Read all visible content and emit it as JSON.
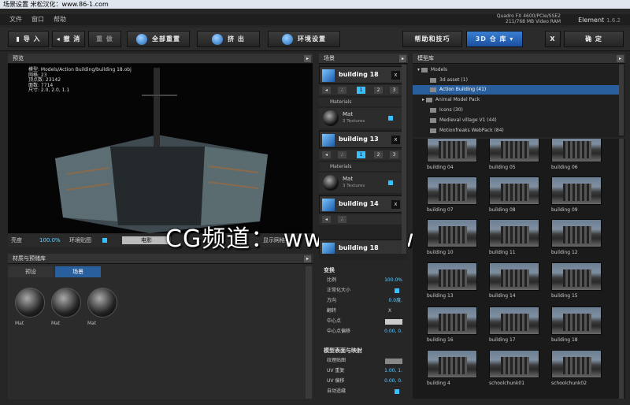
{
  "titlebar": {
    "title": "场景设置 米松汉化：www.86-1.com"
  },
  "menu": [
    "文件",
    "窗口",
    "帮助"
  ],
  "gpu": {
    "line1": "Quadro FX 4600/PCIe/SSE2",
    "line2": "211/768 MB Video RAM"
  },
  "app": {
    "name": "Element",
    "version": "1.6.2"
  },
  "toolbar": {
    "import": "导 入",
    "undo": "撤 消",
    "redo": "重 做",
    "reset": "全部重置",
    "export": "挤 出",
    "env": "环境设置",
    "help": "帮助和技巧",
    "store": "3D 仓 库",
    "close": "X",
    "ok": "确 定"
  },
  "preview": {
    "title": "预览",
    "info": [
      "模型: Models/Action Building/building 18.obj",
      "网格: 23",
      "顶点数: 23142",
      "面数: 7714",
      "尺寸: 2.0, 2.0, 1.1"
    ]
  },
  "vpbar": {
    "bright_label": "亮度",
    "bright_value": "100.0%",
    "env_label": "环境贴图",
    "mode": "电影",
    "grid": "显示网格"
  },
  "watermark": "CG频道： www.cgown.com",
  "materials": {
    "title": "材质与预储库",
    "tab_preset": "预设",
    "tab_scene": "场景",
    "items": [
      "Mat",
      "Mat",
      "Mat"
    ]
  },
  "scene": {
    "title": "场景",
    "objects": [
      "building 18",
      "building 13",
      "building 14",
      "building 18"
    ],
    "materials_label": "Materials",
    "mat_name": "Mat",
    "mat_tex": "3 Textures",
    "nums": [
      "1",
      "2",
      "3"
    ]
  },
  "props": {
    "transform": "变换",
    "scale": "比例",
    "scale_v": "100.0%",
    "normalize": "正常化大小",
    "dir": "方向",
    "dir_v": "0.0度.",
    "flip": "翻转",
    "flip_v": "X",
    "center": "中心点",
    "offset": "中心点偏移",
    "offset_v": "0.00, 0.",
    "mapping": "模型表面与映射",
    "texmap": "纹理贴图",
    "uvrep": "UV 重复",
    "uvrep_v": "1.00, 1.",
    "uvoff": "UV 偏移",
    "uvoff_v": "0.00, 0.",
    "autoseam": "自动适缝"
  },
  "library": {
    "title": "模型库",
    "tree": [
      "Models",
      "3d asset (1)",
      "Action Building (41)",
      "Animal Model Pack",
      "Icons (30)",
      "Medieval village V1 (44)",
      "Motionfreaks WebPack (84)"
    ]
  },
  "thumbs": [
    "building 04",
    "building 05",
    "building 06",
    "building 07",
    "building 08",
    "building 09",
    "building 10",
    "building 11",
    "building 12",
    "building 13",
    "building 14",
    "building 15",
    "building 16",
    "building 17",
    "building 18",
    "building 4",
    "schoolchunk01",
    "schoolchunk02"
  ],
  "colors": {
    "accent": "#39c0ff",
    "selected": "#2a5f9e"
  }
}
